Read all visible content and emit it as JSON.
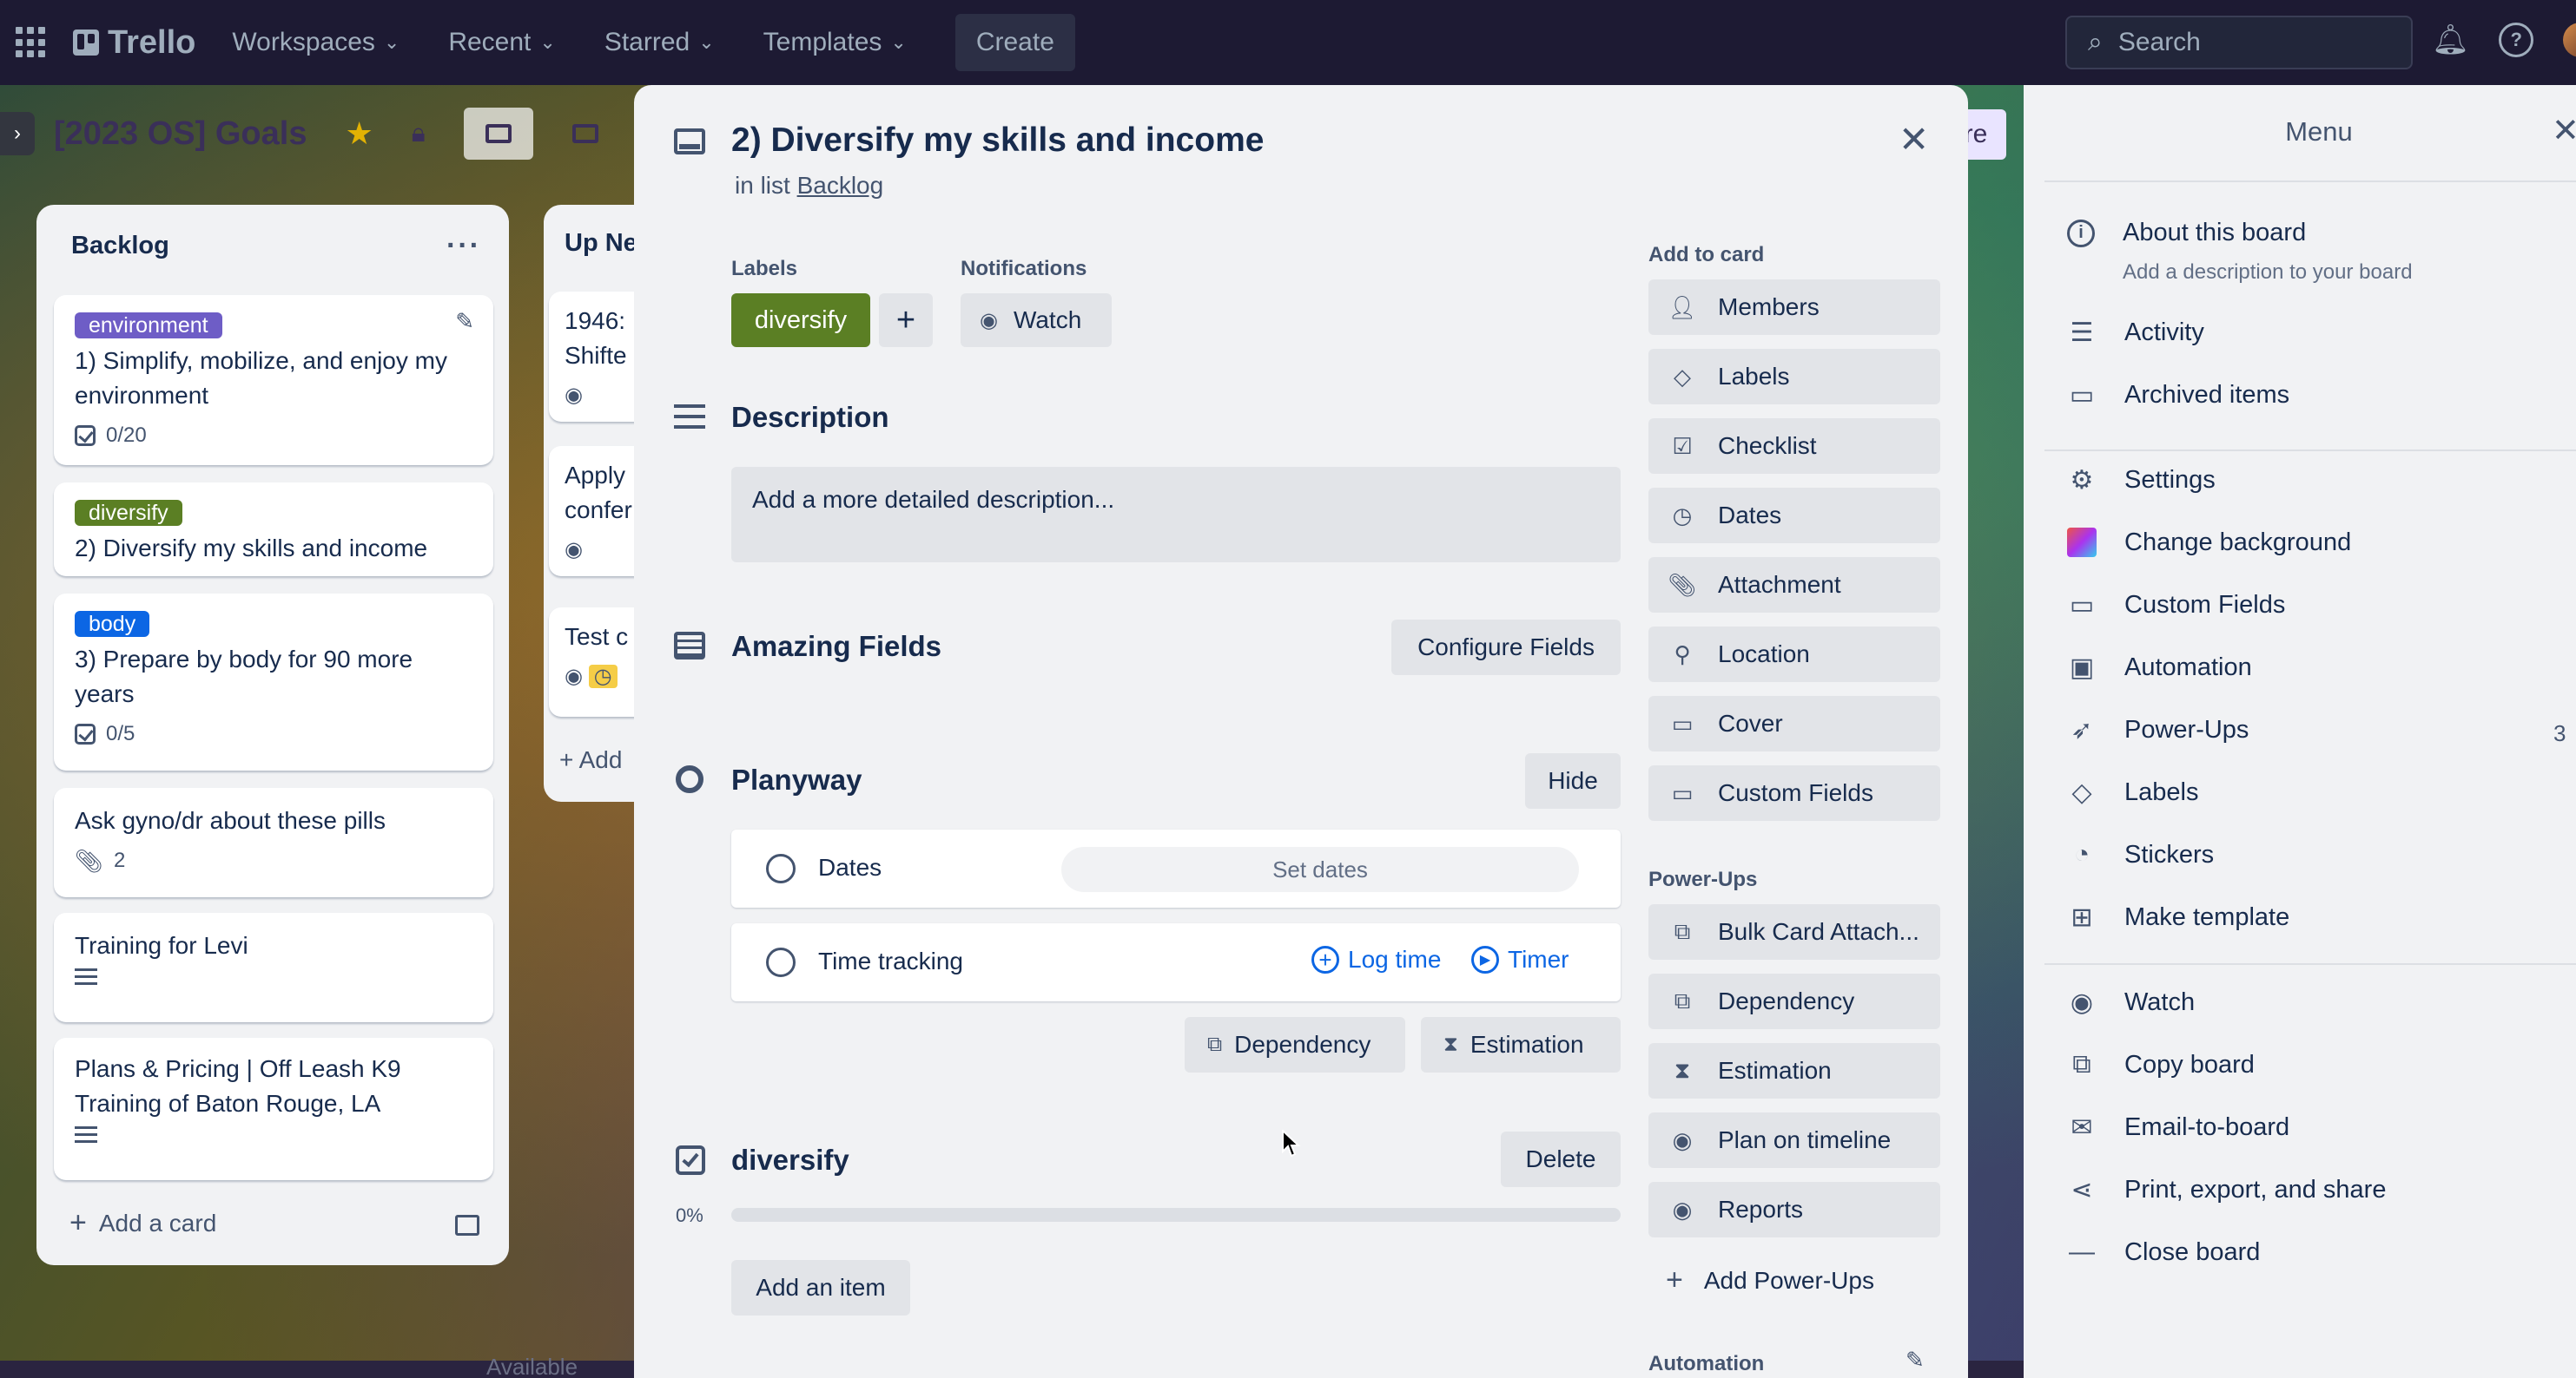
{
  "topnav": {
    "logo": "Trello",
    "menus": [
      "Workspaces",
      "Recent",
      "Starred",
      "Templates"
    ],
    "create": "Create",
    "search_placeholder": "Search"
  },
  "boardbar": {
    "title": "[2023 OS] Goals",
    "share_fragment": "re"
  },
  "lists": {
    "backlog": {
      "title": "Backlog",
      "cards": [
        {
          "label": "environment",
          "label_color": "#6e5dc6",
          "title": "1) Simplify, mobilize, and enjoy my environment",
          "badge": "0/20"
        },
        {
          "label": "diversify",
          "label_color": "#5b7f24",
          "title": "2) Diversify my skills and income"
        },
        {
          "label": "body",
          "label_color": "#0c66e4",
          "title": "3) Prepare by body for 90 more years",
          "badge": "0/5"
        },
        {
          "title": "Ask gyno/dr about these pills",
          "badge": "2"
        },
        {
          "title": "Training for Levi"
        },
        {
          "title": "Plans & Pricing | Off Leash K9 Training of Baton Rouge, LA"
        }
      ],
      "add_card": "Add a card"
    },
    "upnext": {
      "title": "Up Ne",
      "cards": [
        {
          "line1": "1946:",
          "line2": "Shifte"
        },
        {
          "line1": "Apply",
          "line2": "confer"
        },
        {
          "line1": "Test c"
        }
      ],
      "add_fragment": "Add"
    }
  },
  "modal": {
    "title": "2) Diversify my skills and income",
    "in_list_prefix": "in list",
    "in_list_name": "Backlog",
    "labels_head": "Labels",
    "label_value": "diversify",
    "notifications_head": "Notifications",
    "watch": "Watch",
    "description_title": "Description",
    "description_placeholder": "Add a more detailed description...",
    "amazing_fields_title": "Amazing Fields",
    "configure_fields": "Configure Fields",
    "planyway_title": "Planyway",
    "hide": "Hide",
    "dates_label": "Dates",
    "set_dates": "Set dates",
    "time_tracking": "Time tracking",
    "log_time": "Log time",
    "timer": "Timer",
    "dependency": "Dependency",
    "estimation": "Estimation",
    "checklist_title": "diversify",
    "delete": "Delete",
    "progress_label": "0%",
    "progress": 0,
    "add_item": "Add an item",
    "add_to_card_head": "Add to card",
    "add_to_card": [
      "Members",
      "Labels",
      "Checklist",
      "Dates",
      "Attachment",
      "Location",
      "Cover",
      "Custom Fields"
    ],
    "powerups_head": "Power-Ups",
    "powerups": [
      "Bulk Card Attach...",
      "Dependency",
      "Estimation",
      "Plan on timeline",
      "Reports"
    ],
    "add_powerups": "Add Power-Ups",
    "automation_fragment": "Automation"
  },
  "menu": {
    "title": "Menu",
    "about": "About this board",
    "about_sub": "Add a description to your board",
    "items1": [
      "Activity",
      "Archived items"
    ],
    "items2": [
      "Settings",
      "Change background",
      "Custom Fields",
      "Automation",
      "Power-Ups",
      "Labels",
      "Stickers",
      "Make template"
    ],
    "powerups_count": "3",
    "items3": [
      "Watch",
      "Copy board",
      "Email-to-board",
      "Print, export, and share",
      "Close board"
    ]
  },
  "bottom": {
    "status_fragment": "Available"
  }
}
